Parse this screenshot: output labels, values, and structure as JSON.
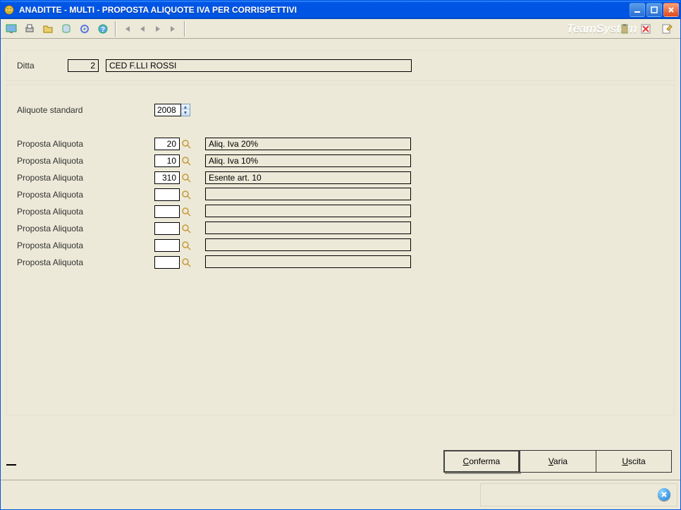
{
  "window": {
    "title": "ANADITTE  - MULTI -  PROPOSTA ALIQUOTE IVA PER CORRISPETTIVI"
  },
  "brand": "TeamSystem",
  "ditta": {
    "label": "Ditta",
    "code": "2",
    "name": "CED F.LLI ROSSI"
  },
  "aliquote_standard": {
    "label": "Aliquote standard",
    "year": "2008"
  },
  "rows": [
    {
      "label": "Proposta Aliquota",
      "code": "20",
      "desc": "Aliq. Iva 20%"
    },
    {
      "label": "Proposta Aliquota",
      "code": "10",
      "desc": "Aliq. Iva 10%"
    },
    {
      "label": "Proposta Aliquota",
      "code": "310",
      "desc": "Esente art. 10"
    },
    {
      "label": "Proposta Aliquota",
      "code": "",
      "desc": ""
    },
    {
      "label": "Proposta Aliquota",
      "code": "",
      "desc": ""
    },
    {
      "label": "Proposta Aliquota",
      "code": "",
      "desc": ""
    },
    {
      "label": "Proposta Aliquota",
      "code": "",
      "desc": ""
    },
    {
      "label": "Proposta Aliquota",
      "code": "",
      "desc": ""
    }
  ],
  "buttons": {
    "confirm_prefix": "C",
    "confirm_rest": "onferma",
    "varia_prefix": "V",
    "varia_rest": "aria",
    "uscita_prefix": "U",
    "uscita_rest": "scita"
  }
}
